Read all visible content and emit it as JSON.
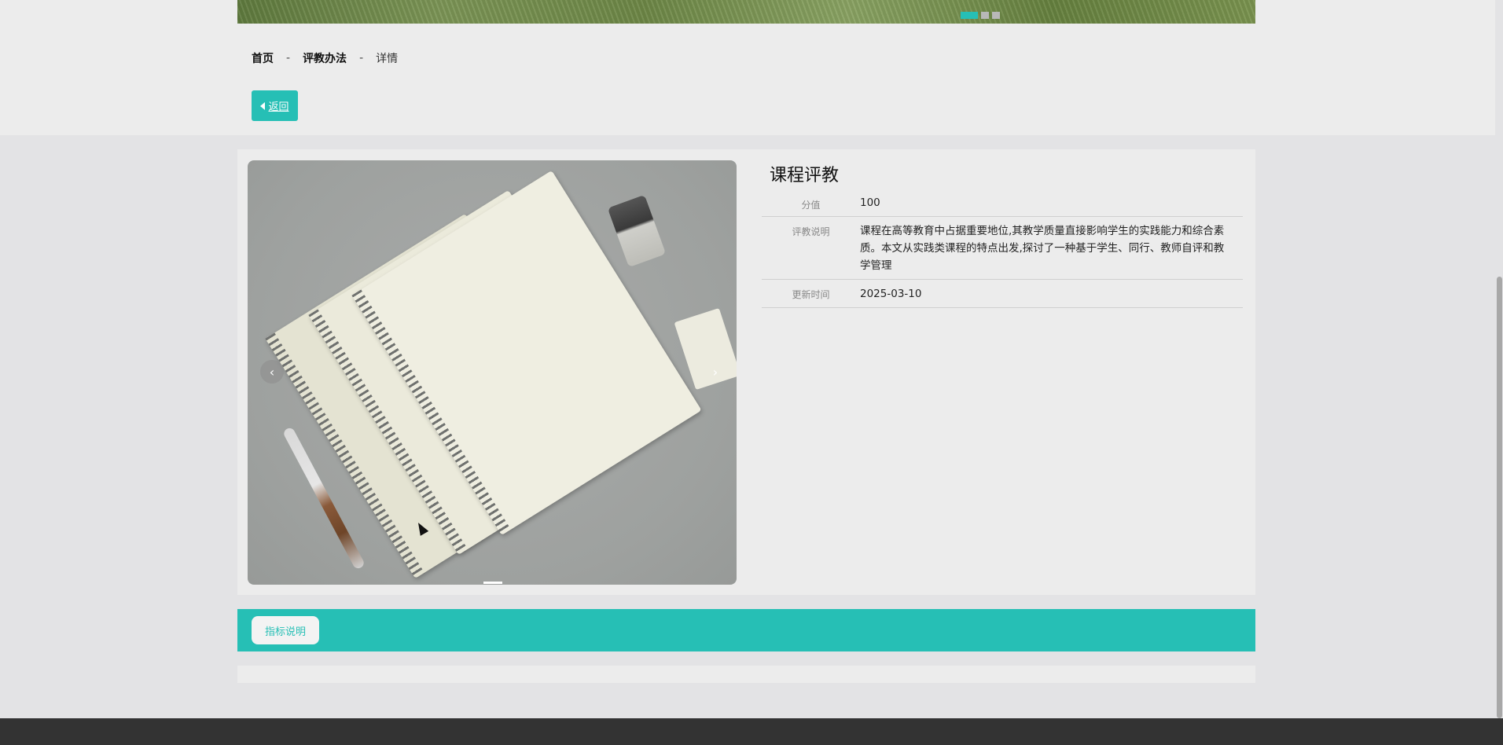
{
  "breadcrumb": {
    "home": "首页",
    "section": "评教办法",
    "current": "详情",
    "separator": "-"
  },
  "back_button": {
    "label": "返回"
  },
  "detail": {
    "title": "课程评教",
    "rows": [
      {
        "label": "分值",
        "value": "100"
      },
      {
        "label": "评教说明",
        "value": "课程在高等教育中占据重要地位,其教学质量直接影响学生的实践能力和综合素质。本文从实践类课程的特点出发,探讨了一种基于学生、同行、教师自评和教学管理"
      },
      {
        "label": "更新时间",
        "value": "2025-03-10"
      }
    ]
  },
  "carousel": {
    "prev_glyph": "‹",
    "next_glyph": "›"
  },
  "tabs": [
    {
      "label": "指标说明"
    }
  ],
  "colors": {
    "accent": "#26bfb5",
    "footer": "#333333",
    "page_bg": "#e3e3e5"
  },
  "icons": {
    "back": "caret-left-icon",
    "prev": "chevron-left-icon",
    "next": "chevron-right-icon"
  }
}
